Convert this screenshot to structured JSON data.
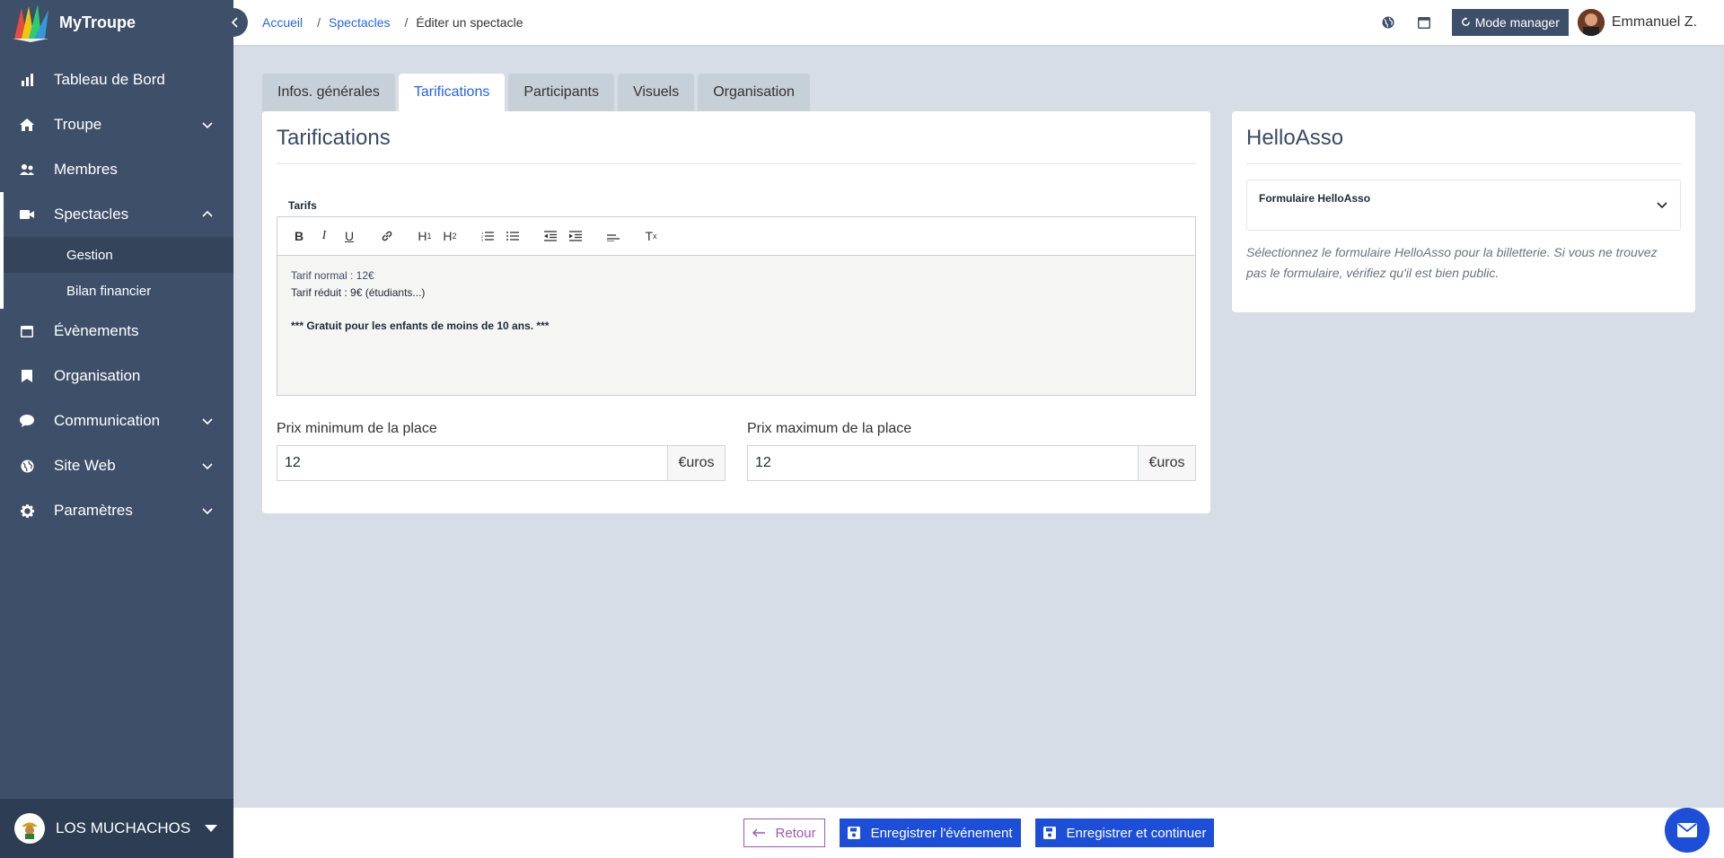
{
  "app": {
    "name": "MyTroupe"
  },
  "sidebar": {
    "items": [
      {
        "label": "Tableau de Bord",
        "icon": "chart-bar-icon"
      },
      {
        "label": "Troupe",
        "icon": "home-icon"
      },
      {
        "label": "Membres",
        "icon": "users-icon"
      },
      {
        "label": "Spectacles",
        "icon": "video-icon"
      },
      {
        "label": "Évènements",
        "icon": "calendar-icon"
      },
      {
        "label": "Organisation",
        "icon": "bookmark-icon"
      },
      {
        "label": "Communication",
        "icon": "chat-icon"
      },
      {
        "label": "Site Web",
        "icon": "globe-icon"
      },
      {
        "label": "Paramètres",
        "icon": "gear-icon"
      }
    ],
    "spectacles_sub": [
      {
        "label": "Gestion"
      },
      {
        "label": "Bilan financier"
      }
    ],
    "organization": "LOS MUCHACHOS"
  },
  "breadcrumb": {
    "home": "Accueil",
    "section": "Spectacles",
    "current": "Éditer un spectacle"
  },
  "header": {
    "mode_button": "Mode manager",
    "user_name": "Emmanuel Z."
  },
  "tabs": [
    {
      "label": "Infos. générales"
    },
    {
      "label": "Tarifications"
    },
    {
      "label": "Participants"
    },
    {
      "label": "Visuels"
    },
    {
      "label": "Organisation"
    }
  ],
  "pricing": {
    "title": "Tarifications",
    "editor_label": "Tarifs",
    "editor_lines": [
      "Tarif normal : 12€",
      "Tarif réduit : 9€ (étudiants...)",
      "*** Gratuit pour les enfants de moins de 10 ans. ***"
    ],
    "min_label": "Prix minimum de la place",
    "min_value": "12",
    "max_label": "Prix maximum de la place",
    "max_value": "12",
    "currency_suffix": "€uros"
  },
  "helloasso": {
    "title": "HelloAsso",
    "select_label": "Formulaire HelloAsso",
    "help_text": "Sélectionnez le formulaire HelloAsso pour la billetterie. Si vous ne trouvez pas le formulaire, vérifiez qu'il est bien public."
  },
  "footer": {
    "back": "Retour",
    "save": "Enregistrer l'événement",
    "save_continue": "Enregistrer et continuer"
  },
  "colors": {
    "sidebar": "#3e5069",
    "accent": "#2563eb",
    "primary_button": "#1d4ed8",
    "back_button": "#9b59b6"
  }
}
